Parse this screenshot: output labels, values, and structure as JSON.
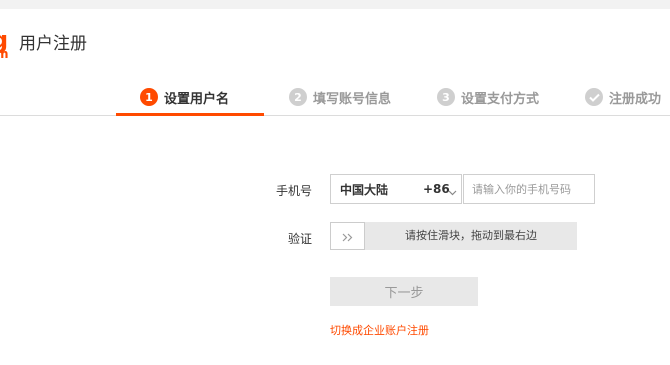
{
  "header": {
    "logo_glyph": "g",
    "logo_sub": "m",
    "title": "用户注册"
  },
  "steps": [
    {
      "num": "1",
      "label": "设置用户名",
      "active": true
    },
    {
      "num": "2",
      "label": "填写账号信息",
      "active": false
    },
    {
      "num": "3",
      "label": "设置支付方式",
      "active": false
    },
    {
      "num": "",
      "label": "注册成功",
      "icon": "check-icon",
      "active": false
    }
  ],
  "form": {
    "phone_label": "手机号",
    "country_name": "中国大陆",
    "country_code": "+86",
    "phone_placeholder": "请输入你的手机号码",
    "verify_label": "验证",
    "slider_text": "请按住滑块，拖动到最右边",
    "next_label": "下一步",
    "switch_link": "切换成企业账户注册"
  },
  "colors": {
    "accent": "#ff4a00",
    "inactive_step": "#cfcfcf",
    "button_disabled_bg": "#e8e8e8"
  }
}
